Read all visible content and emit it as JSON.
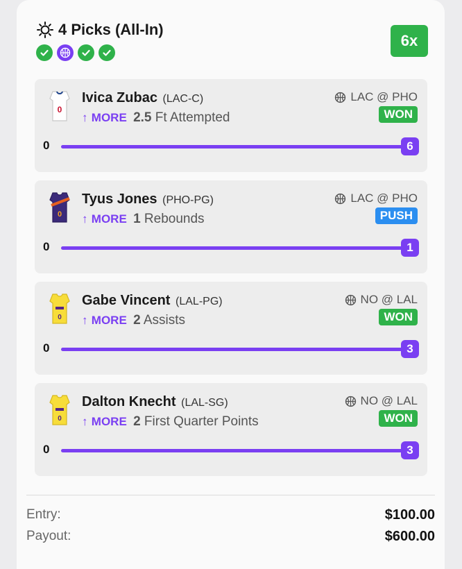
{
  "header": {
    "title": "4 Picks (All-In)",
    "multiplier": "6x",
    "status_icons": [
      "check-icon",
      "basketball-icon",
      "check-icon",
      "check-icon"
    ]
  },
  "colors": {
    "accent": "#7a3ff2",
    "won": "#2fb24a",
    "push": "#2b8ef0"
  },
  "picks": [
    {
      "player": "Ivica Zubac",
      "team_pos": "(LAC-C)",
      "direction": "MORE",
      "line": "2.5",
      "stat": "Ft Attempted",
      "matchup": "LAC @ PHO",
      "result": "WON",
      "min_label": "0",
      "actual": "6"
    },
    {
      "player": "Tyus Jones",
      "team_pos": "(PHO-PG)",
      "direction": "MORE",
      "line": "1",
      "stat": "Rebounds",
      "matchup": "LAC @ PHO",
      "result": "PUSH",
      "min_label": "0",
      "actual": "1"
    },
    {
      "player": "Gabe Vincent",
      "team_pos": "(LAL-PG)",
      "direction": "MORE",
      "line": "2",
      "stat": "Assists",
      "matchup": "NO @ LAL",
      "result": "WON",
      "min_label": "0",
      "actual": "3"
    },
    {
      "player": "Dalton Knecht",
      "team_pos": "(LAL-SG)",
      "direction": "MORE",
      "line": "2",
      "stat": "First Quarter Points",
      "matchup": "NO @ LAL",
      "result": "WON",
      "min_label": "0",
      "actual": "3"
    }
  ],
  "summary": {
    "entry_label": "Entry:",
    "entry_value": "$100.00",
    "payout_label": "Payout:",
    "payout_value": "$600.00"
  }
}
